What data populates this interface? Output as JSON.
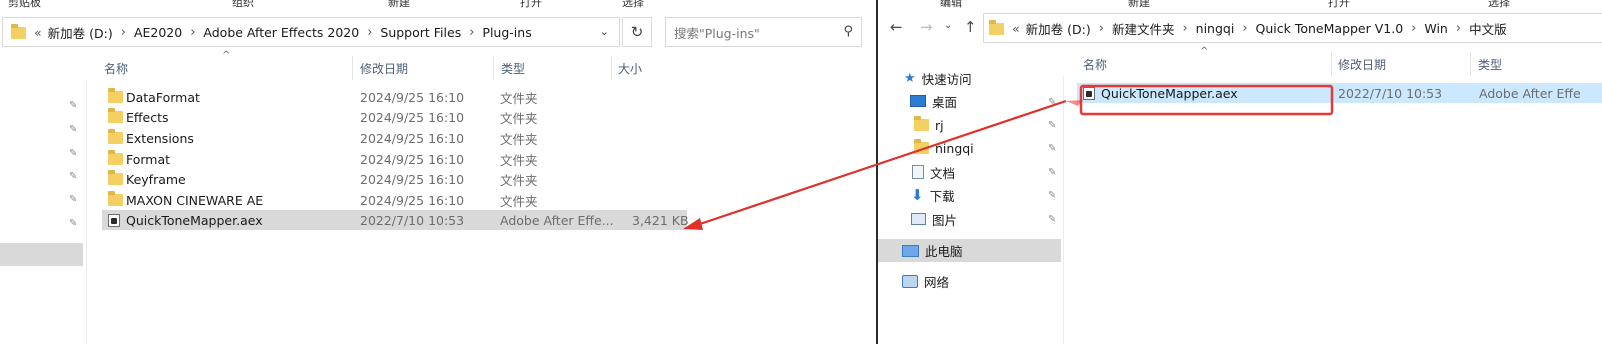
{
  "left": {
    "ribbon": [
      "剪贴板",
      "组织",
      "新建",
      "打开",
      "选择"
    ],
    "address": {
      "overflow": "«",
      "crumbs": [
        "新加卷 (D:)",
        "AE2020",
        "Adobe After Effects 2020",
        "Support Files",
        "Plug-ins"
      ],
      "dropdown_icon": "chevron-down-icon",
      "refresh_icon": "refresh-icon"
    },
    "search": {
      "placeholder": "搜索\"Plug-ins\""
    },
    "columns": {
      "name": "名称",
      "date": "修改日期",
      "type": "类型",
      "size": "大小"
    },
    "files": [
      {
        "name": "DataFormat",
        "date": "2024/9/25 16:10",
        "type": "文件夹",
        "size": "",
        "kind": "folder"
      },
      {
        "name": "Effects",
        "date": "2024/9/25 16:10",
        "type": "文件夹",
        "size": "",
        "kind": "folder"
      },
      {
        "name": "Extensions",
        "date": "2024/9/25 16:10",
        "type": "文件夹",
        "size": "",
        "kind": "folder"
      },
      {
        "name": "Format",
        "date": "2024/9/25 16:10",
        "type": "文件夹",
        "size": "",
        "kind": "folder"
      },
      {
        "name": "Keyframe",
        "date": "2024/9/25 16:10",
        "type": "文件夹",
        "size": "",
        "kind": "folder"
      },
      {
        "name": "MAXON CINEWARE AE",
        "date": "2024/9/25 16:10",
        "type": "文件夹",
        "size": "",
        "kind": "folder"
      },
      {
        "name": "QuickToneMapper.aex",
        "date": "2022/7/10 10:53",
        "type": "Adobe After Effe...",
        "size": "3,421 KB",
        "kind": "file",
        "selected": true
      }
    ]
  },
  "right": {
    "ribbon": [
      "编辑",
      "新建",
      "打开",
      "选择"
    ],
    "address": {
      "overflow": "«",
      "crumbs": [
        "新加卷 (D:)",
        "新建文件夹",
        "ningqi",
        "Quick ToneMapper V1.0",
        "Win",
        "中文版"
      ]
    },
    "nav": {
      "quick_access": "快速访问",
      "items": [
        {
          "label": "桌面",
          "icon": "desktop-icon"
        },
        {
          "label": "rj",
          "icon": "folder-icon"
        },
        {
          "label": "ningqi",
          "icon": "folder-icon"
        },
        {
          "label": "文档",
          "icon": "document-icon"
        },
        {
          "label": "下载",
          "icon": "download-icon"
        },
        {
          "label": "图片",
          "icon": "pictures-icon"
        }
      ],
      "this_pc": "此电脑",
      "network": "网络"
    },
    "columns": {
      "name": "名称",
      "date": "修改日期",
      "type": "类型"
    },
    "files": [
      {
        "name": "QuickToneMapper.aex",
        "date": "2022/7/10 10:53",
        "type": "Adobe After Effe",
        "kind": "file",
        "selected": true
      }
    ]
  },
  "colors": {
    "highlight_box": "#e53935",
    "arrow": "#e0302a",
    "selected_row": "#cce8ff",
    "selected_row_gray": "#d9d9d9"
  }
}
